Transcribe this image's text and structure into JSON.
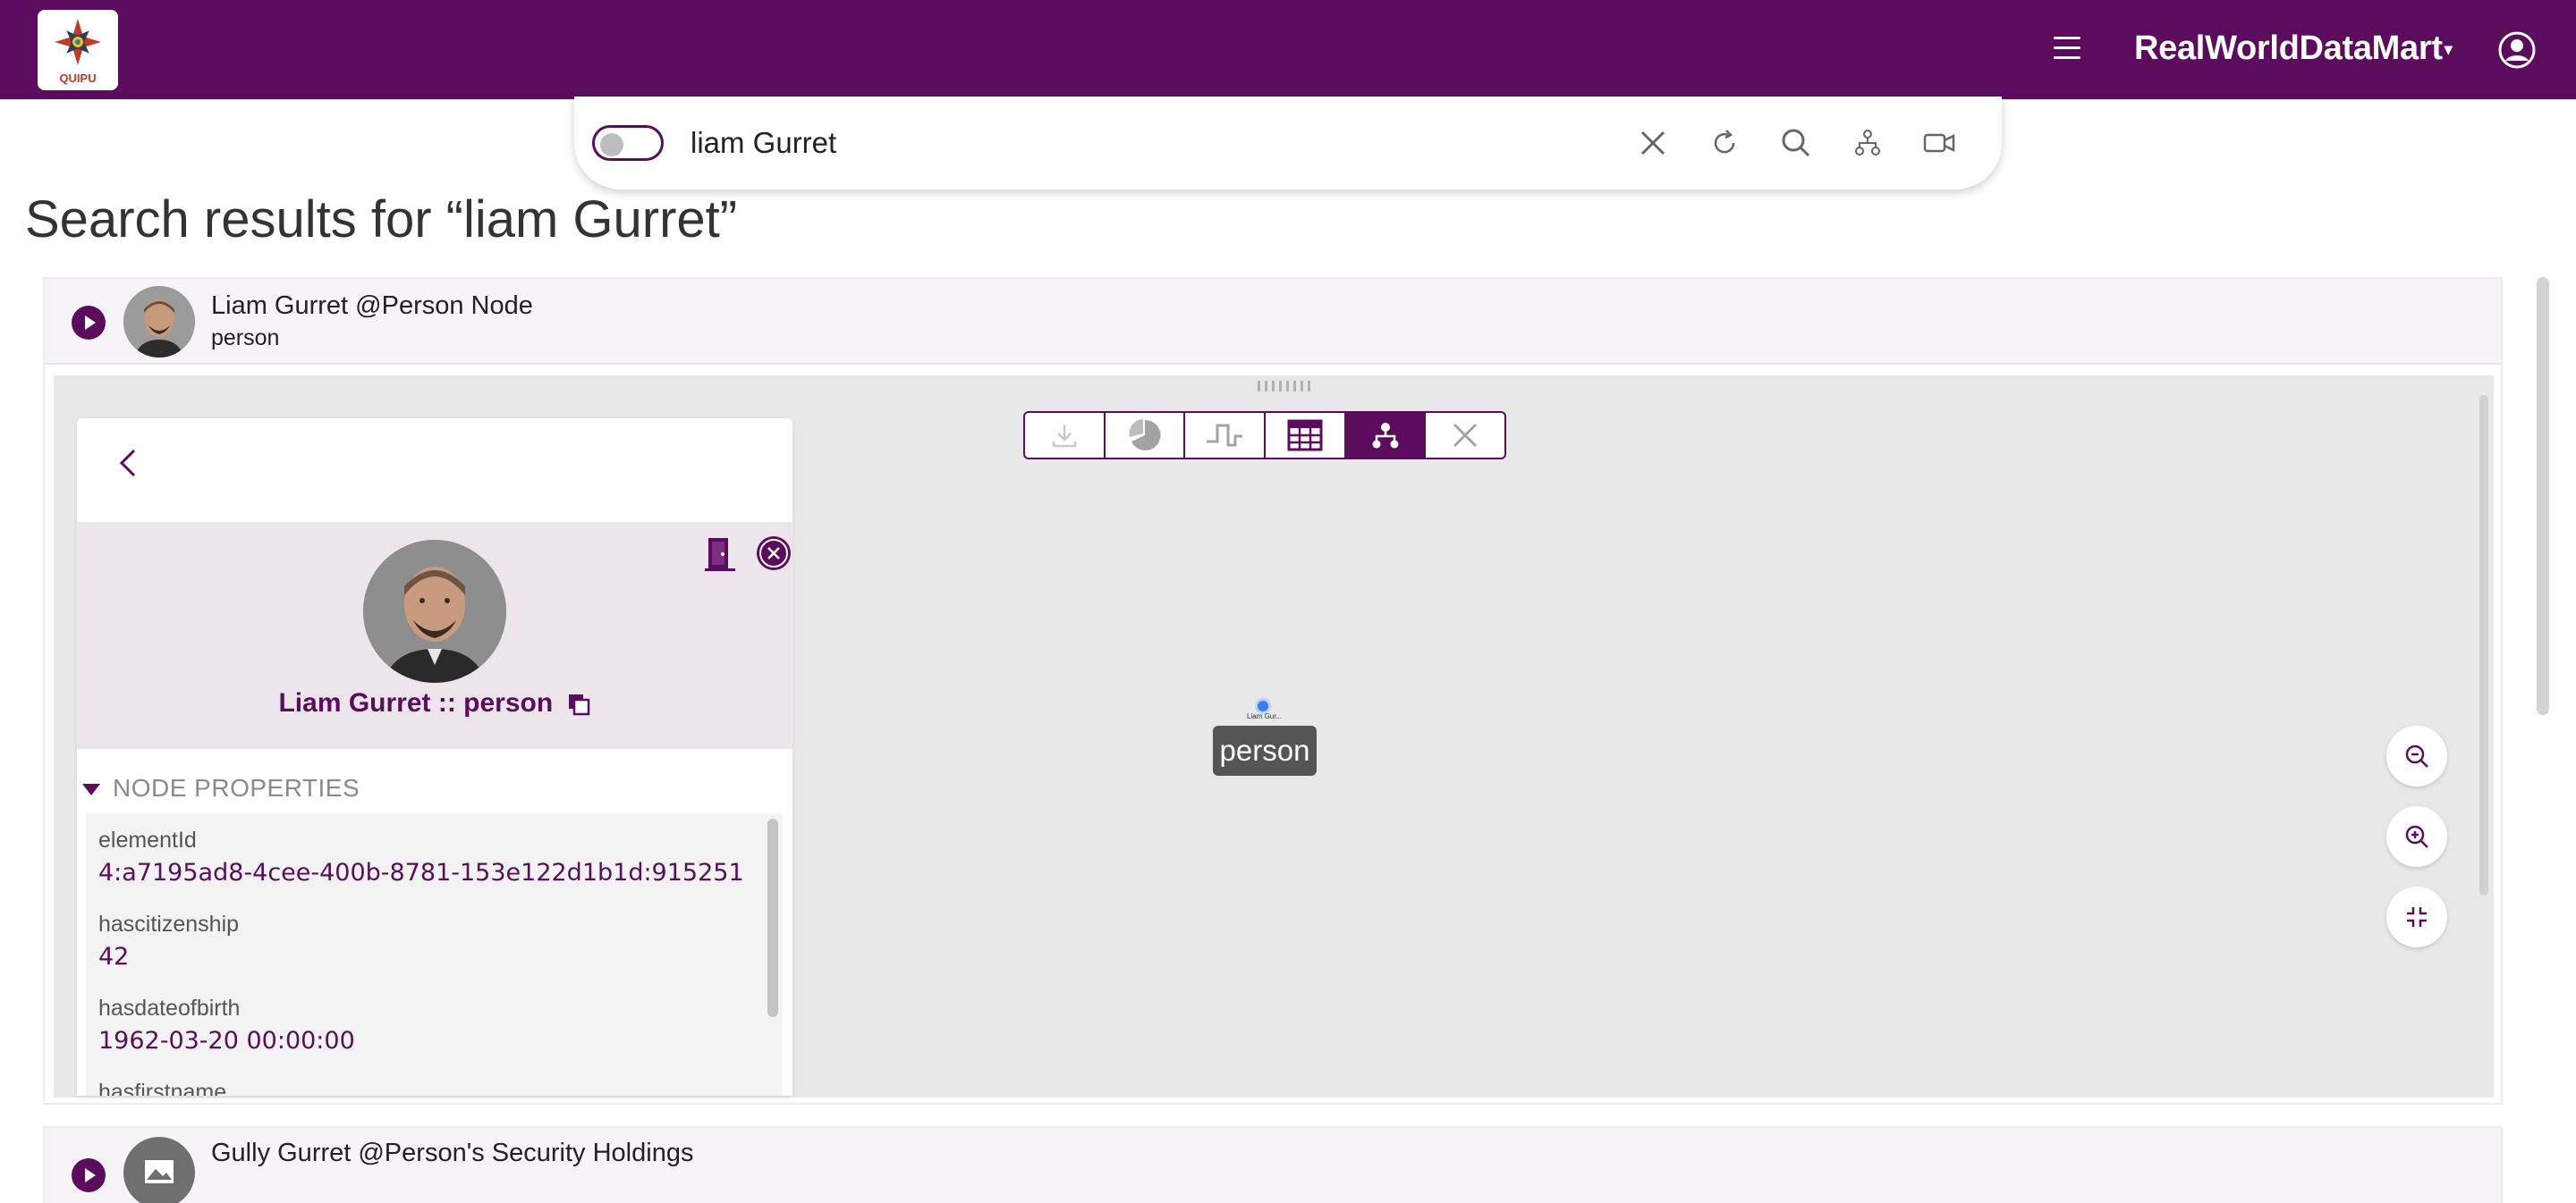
{
  "header": {
    "logo_text": "QUIPU",
    "brand": "RealWorldDataMart",
    "brand_caret": "▾",
    "menu_icon": "hamburger-menu-icon",
    "user_icon": "user-account-icon",
    "bg_color": "#5c0c5d"
  },
  "search": {
    "value": "liam Gurret",
    "toggle_on": false,
    "icons": [
      "close-icon",
      "refresh-icon",
      "search-icon",
      "graph-tree-icon",
      "video-camera-icon"
    ]
  },
  "page_title": "Search results for “liam Gurret”",
  "results": [
    {
      "title": "Liam Gurret @Person Node",
      "subtitle": "person",
      "expanded": true
    },
    {
      "title": "Gully Gurret @Person's Security Holdings",
      "subtitle": "",
      "expanded": false
    }
  ],
  "toolbar": {
    "buttons": [
      "download-icon",
      "pie-chart-icon",
      "step-chart-icon",
      "table-icon",
      "graph-tree-icon",
      "close-icon"
    ],
    "active": "graph-tree-icon"
  },
  "node_panel": {
    "name": "Liam Gurret :: person",
    "section_label": "NODE PROPERTIES",
    "properties": [
      {
        "key": "elementId",
        "value": "4:a7195ad8-4cee-400b-8781-153e122d1b1d:915251"
      },
      {
        "key": "hascitizenship",
        "value": "42"
      },
      {
        "key": "hasdateofbirth",
        "value": "1962-03-20 00:00:00"
      },
      {
        "key": "hasfirstname",
        "value": ""
      }
    ]
  },
  "graph": {
    "node_label": "Liam Gur...",
    "node_tooltip": "person",
    "zoom_controls": [
      "zoom-out-icon",
      "zoom-in-icon",
      "fit-screen-icon"
    ]
  },
  "accent_color": "#5c0c5d"
}
